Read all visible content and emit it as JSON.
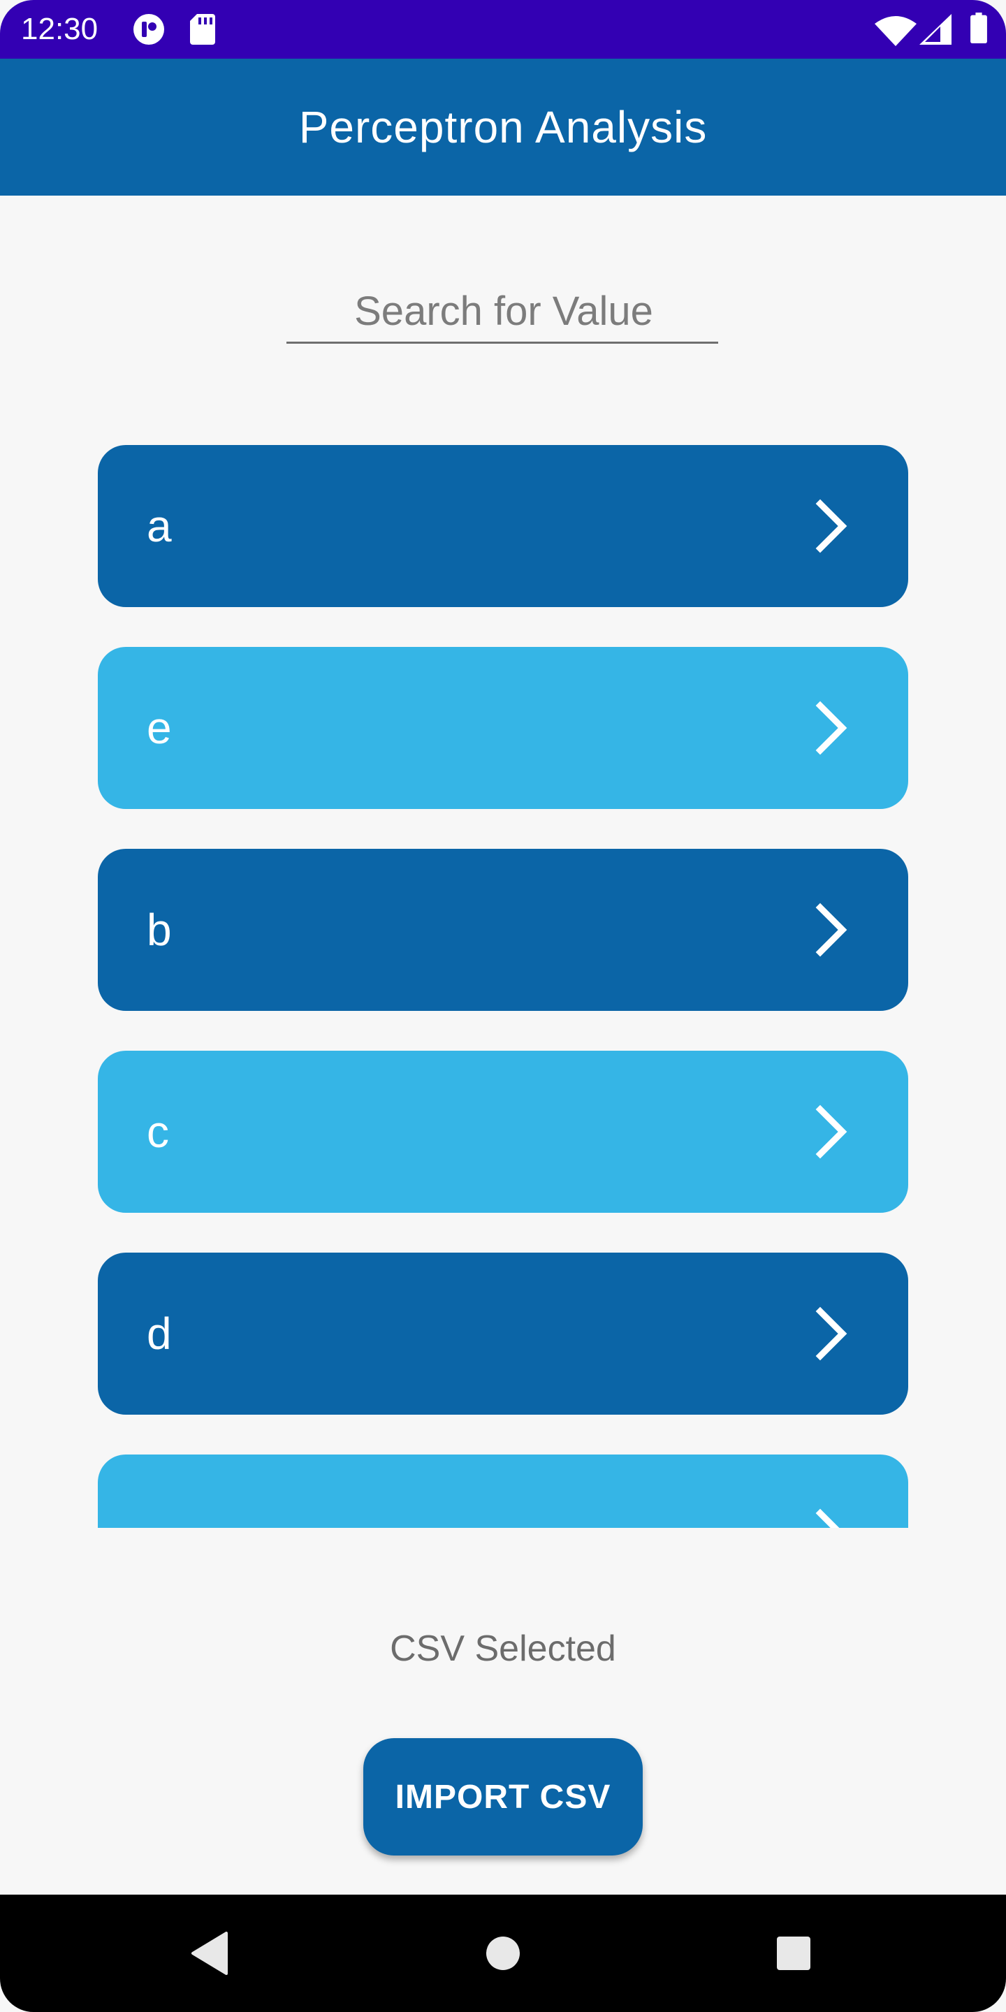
{
  "status_bar": {
    "time": "12:30",
    "icons": [
      "app-logo-icon",
      "sd-card-icon",
      "wifi-icon",
      "signal-icon",
      "battery-icon"
    ]
  },
  "app_bar": {
    "title": "Perceptron Analysis"
  },
  "search": {
    "placeholder": "Search for Value",
    "value": ""
  },
  "list": {
    "items": [
      {
        "label": "a",
        "style": "dark"
      },
      {
        "label": "e",
        "style": "light"
      },
      {
        "label": "b",
        "style": "dark"
      },
      {
        "label": "c",
        "style": "light"
      },
      {
        "label": "d",
        "style": "dark"
      },
      {
        "label": "",
        "style": "light"
      }
    ],
    "item_icon": "chevron-right-icon"
  },
  "csv_status": "CSV Selected",
  "import_button": {
    "label": "IMPORT CSV"
  },
  "nav_bar": {
    "buttons": [
      "back-icon",
      "home-icon",
      "recents-icon"
    ]
  },
  "colors": {
    "status_bar": "#3300b3",
    "primary": "#0b65a7",
    "accent": "#35b5e6",
    "background": "#f7f7f7"
  }
}
